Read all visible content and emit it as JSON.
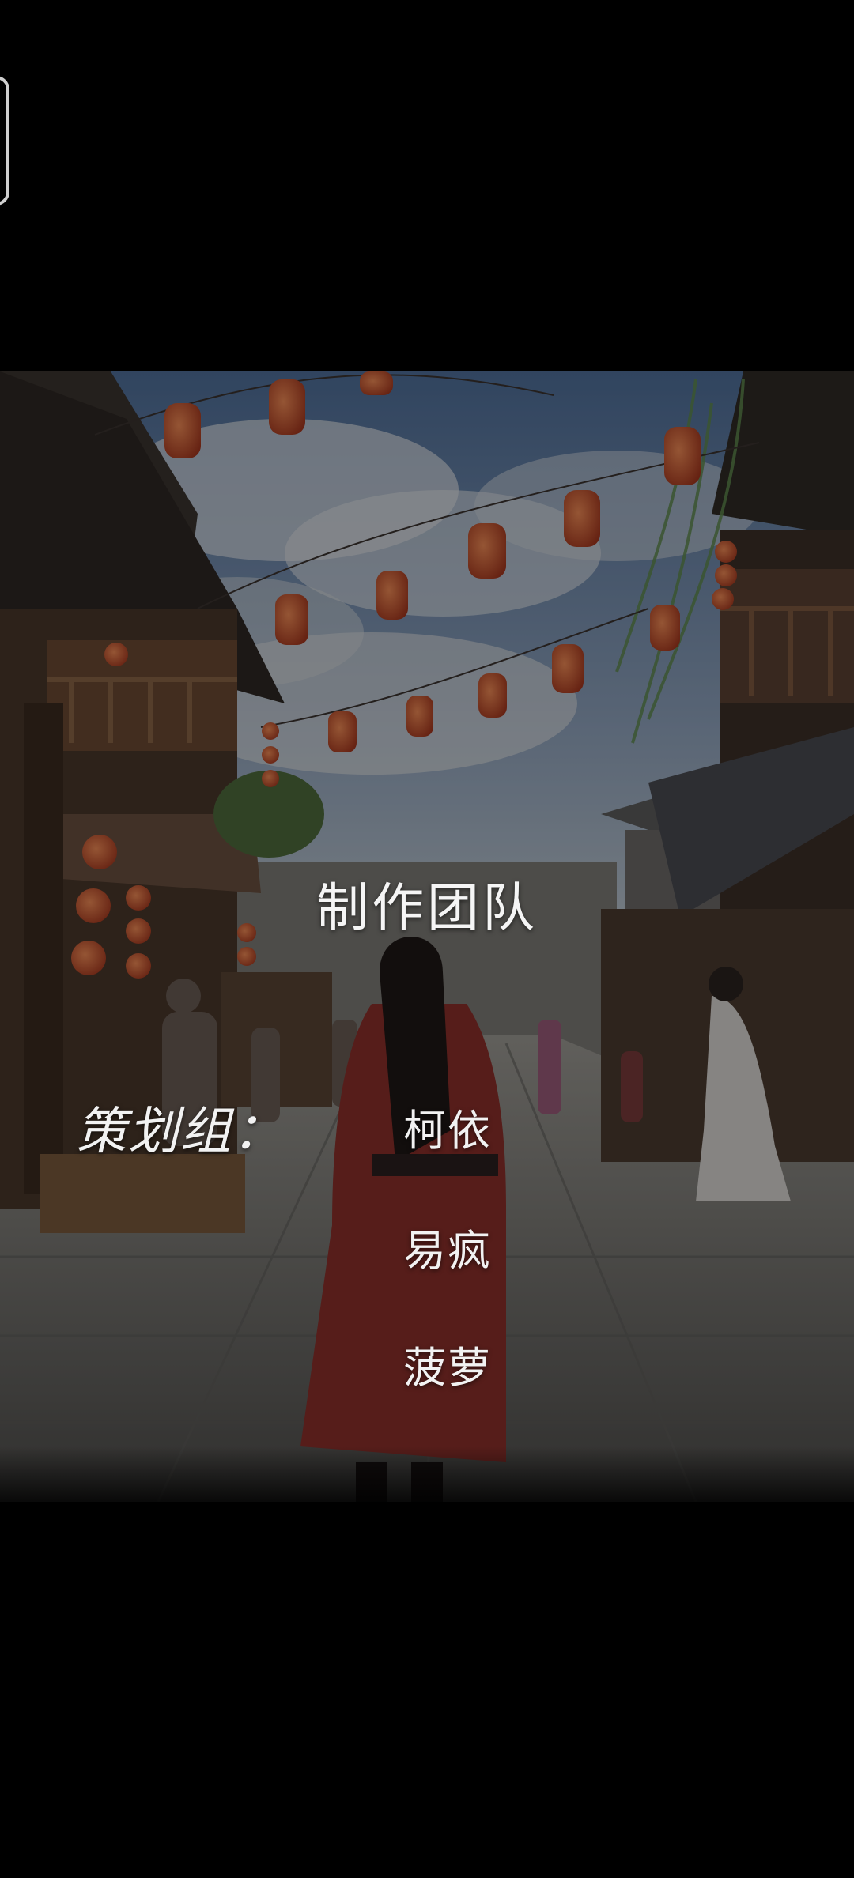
{
  "credits": {
    "title": "制作团队",
    "role_label": "策划组：",
    "members": [
      "柯依",
      "易疯",
      "菠萝"
    ]
  },
  "colors": {
    "background": "#000000",
    "text": "#f2f2f2",
    "lantern": "#c4532f"
  },
  "icons": {
    "side_handle": "edge-handle-icon"
  }
}
